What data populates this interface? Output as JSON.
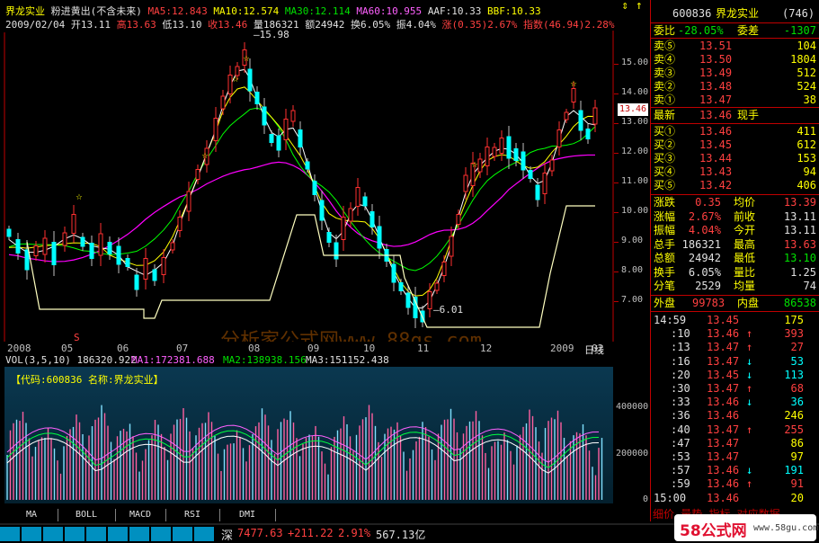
{
  "header": {
    "stock_name": "界龙实业",
    "mode": "粉进黄出(不含未来)",
    "ma5": "MA5:12.843",
    "ma10": "MA10:12.574",
    "ma30": "MA30:12.114",
    "ma60": "MA60:10.955",
    "aaf": "AAF:10.33",
    "bbf": "BBF:10.33",
    "date": "2009/02/04",
    "open": "开13.11",
    "high": "高13.63",
    "low": "低13.10",
    "close": "收13.46",
    "volume": "量186321",
    "amount": "额24942",
    "turnover": "换6.05%",
    "amplitude": "振4.04%",
    "change": "涨(0.35)2.67%",
    "index": "指数(46.94)2.28%"
  },
  "main_chart": {
    "peak_label": "15.98",
    "trough_label": "6.01",
    "current_price_tag": "13.46",
    "y_ticks": [
      "15.00",
      "14.00",
      "13.00",
      "12.00",
      "11.00",
      "10.00",
      "9.00",
      "8.00",
      "7.00"
    ],
    "x_ticks": [
      "2008",
      "05",
      "06",
      "07",
      "08",
      "09",
      "10",
      "11",
      "12",
      "2009",
      "02"
    ],
    "period_label": "日线",
    "watermark": "分析家公式网www.88gs.com",
    "marker_s": "S",
    "colors": {
      "ma5": "#ffffff",
      "ma10": "#ffff00",
      "ma30": "#ff00ff",
      "ma60": "#00ff00",
      "up": "#ff3030",
      "down": "#00ffff"
    }
  },
  "volume_chart": {
    "header": "VOL(3,5,10) 186320.922",
    "ma1": "MA1:172381.688",
    "ma2": "MA2:138938.156",
    "ma3": "MA3:151152.438",
    "info": "【代码:600836 名称:界龙实业】",
    "y_ticks": [
      "400000",
      "200000",
      "0"
    ]
  },
  "tabs": [
    "MA",
    "BOLL",
    "MACD",
    "RSI",
    "DMI"
  ],
  "right_panel": {
    "code": "600836",
    "name": "界龙实业",
    "rank": "(746)",
    "weibi_label": "委比",
    "weibi": "-28.05%",
    "weicha_label": "委差",
    "weicha": "-1307",
    "sells": [
      {
        "label": "卖⑤",
        "price": "13.51",
        "vol": "104"
      },
      {
        "label": "卖④",
        "price": "13.50",
        "vol": "1804"
      },
      {
        "label": "卖③",
        "price": "13.49",
        "vol": "512"
      },
      {
        "label": "卖②",
        "price": "13.48",
        "vol": "524"
      },
      {
        "label": "卖①",
        "price": "13.47",
        "vol": "38"
      }
    ],
    "latest_label": "最新",
    "latest": "13.46",
    "xianshou_label": "现手",
    "buys": [
      {
        "label": "买①",
        "price": "13.46",
        "vol": "411"
      },
      {
        "label": "买②",
        "price": "13.45",
        "vol": "612"
      },
      {
        "label": "买③",
        "price": "13.44",
        "vol": "153"
      },
      {
        "label": "买④",
        "price": "13.43",
        "vol": "94"
      },
      {
        "label": "买⑤",
        "price": "13.42",
        "vol": "406"
      }
    ],
    "stats": [
      {
        "l1": "涨跌",
        "v1": "0.35",
        "l2": "均价",
        "v2": "13.39"
      },
      {
        "l1": "涨幅",
        "v1": "2.67%",
        "l2": "前收",
        "v2": "13.11"
      },
      {
        "l1": "振幅",
        "v1": "4.04%",
        "l2": "今开",
        "v2": "13.11"
      },
      {
        "l1": "总手",
        "v1": "186321",
        "l2": "最高",
        "v2": "13.63"
      },
      {
        "l1": "总额",
        "v1": "24942",
        "l2": "最低",
        "v2": "13.10"
      },
      {
        "l1": "换手",
        "v1": "6.05%",
        "l2": "量比",
        "v2": "1.25"
      },
      {
        "l1": "分笔",
        "v1": "2529",
        "l2": "均量",
        "v2": "74"
      }
    ],
    "waipan_label": "外盘",
    "waipan": "99783",
    "neipan_label": "内盘",
    "neipan": "86538",
    "ticks": [
      {
        "time": "14:59",
        "price": "13.45",
        "vol": "175",
        "dir": ""
      },
      {
        "time": ":10",
        "price": "13.46",
        "vol": "393",
        "dir": "up"
      },
      {
        "time": ":13",
        "price": "13.47",
        "vol": "27",
        "dir": "up"
      },
      {
        "time": ":16",
        "price": "13.47",
        "vol": "53",
        "dir": "down"
      },
      {
        "time": ":20",
        "price": "13.45",
        "vol": "113",
        "dir": "down"
      },
      {
        "time": ":30",
        "price": "13.47",
        "vol": "68",
        "dir": "up"
      },
      {
        "time": ":33",
        "price": "13.46",
        "vol": "36",
        "dir": "down"
      },
      {
        "time": ":36",
        "price": "13.46",
        "vol": "246",
        "dir": ""
      },
      {
        "time": ":40",
        "price": "13.47",
        "vol": "255",
        "dir": "up"
      },
      {
        "time": ":47",
        "price": "13.47",
        "vol": "86",
        "dir": ""
      },
      {
        "time": ":53",
        "price": "13.47",
        "vol": "97",
        "dir": ""
      },
      {
        "time": ":57",
        "price": "13.46",
        "vol": "191",
        "dir": "down"
      },
      {
        "time": ":59",
        "price": "13.46",
        "vol": "91",
        "dir": "up"
      },
      {
        "time": "15:00",
        "price": "13.46",
        "vol": "20",
        "dir": ""
      }
    ],
    "bottom_tabs": "细价 量势 指标 对应数据"
  },
  "status": {
    "market": "深",
    "index_value": "7477.63",
    "index_change": "+211.22",
    "index_pct": "2.91%",
    "index_amount": "567.13亿"
  },
  "logo": {
    "brand": "58公式网",
    "url": "www.58gu.com"
  }
}
